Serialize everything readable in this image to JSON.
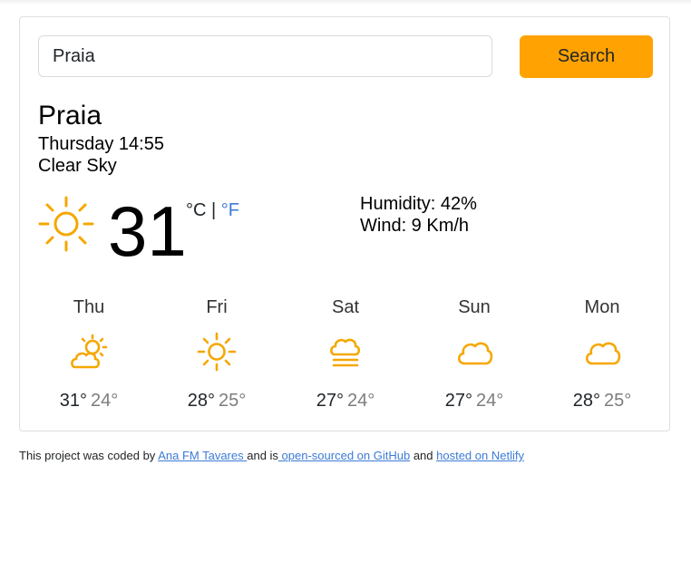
{
  "search": {
    "value": "Praia",
    "button_label": "Search"
  },
  "current": {
    "city": "Praia",
    "datetime": "Thursday 14:55",
    "description": "Clear Sky",
    "icon": "sun-icon",
    "temperature": "31",
    "unit_celsius": "°C",
    "unit_separator": " | ",
    "unit_fahrenheit": "°F",
    "humidity": "Humidity: 42%",
    "wind": "Wind: 9 Km/h"
  },
  "forecast": [
    {
      "day": "Thu",
      "icon": "partly-cloudy-icon",
      "max": "31°",
      "min": "24°"
    },
    {
      "day": "Fri",
      "icon": "sun-icon",
      "max": "28°",
      "min": "25°"
    },
    {
      "day": "Sat",
      "icon": "fog-icon",
      "max": "27°",
      "min": "24°"
    },
    {
      "day": "Sun",
      "icon": "cloud-icon",
      "max": "27°",
      "min": "24°"
    },
    {
      "day": "Mon",
      "icon": "cloud-icon",
      "max": "28°",
      "min": "25°"
    }
  ],
  "footer": {
    "text_1": "This project was coded by ",
    "author_link": "Ana FM Tavares ",
    "text_2": "and is",
    "github_link": " open-sourced on GitHub",
    "text_3": " and ",
    "netlify_link": "hosted on Netlify"
  },
  "colors": {
    "accent": "#ffa202",
    "icon": "#f6a700",
    "link": "#3c7bd6",
    "muted": "#7d7d7d"
  }
}
